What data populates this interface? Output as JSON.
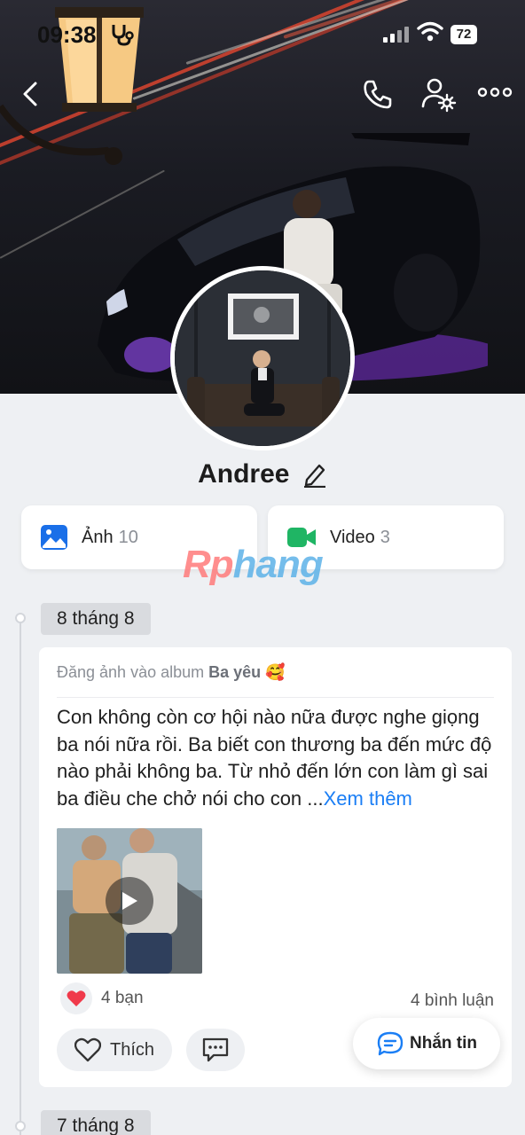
{
  "status_bar": {
    "time": "09:38",
    "battery": "72"
  },
  "header": {
    "back_icon": "chevron-left-icon",
    "call_icon": "phone-icon",
    "manage_icon": "user-settings-icon",
    "more_icon": "more-horizontal-icon"
  },
  "profile": {
    "name": "Andree"
  },
  "media": {
    "photos": {
      "label": "Ảnh",
      "count": "10",
      "color": "#1a6fe8"
    },
    "videos": {
      "label": "Video",
      "count": "3",
      "color": "#1fb564"
    }
  },
  "watermark": {
    "part1": "Rp",
    "part2": "hang"
  },
  "timeline": [
    {
      "date": "8 tháng 8",
      "post": {
        "meta_prefix": "Đăng ảnh vào album",
        "album": "Ba yêu",
        "emoji": "🥰",
        "text": "Con không còn cơ hội nào nữa được nghe giọng ba nói nữa rồi. Ba biết con thương ba đến mức độ nào phải không ba. Từ nhỏ đến lớn con làm gì sai ba điều che chở nói cho con ...",
        "see_more": "Xem thêm",
        "reactions": "4 bạn",
        "comments": "4 bình luận",
        "like_label": "Thích"
      }
    },
    {
      "date": "7 tháng 8"
    }
  ],
  "message_button": {
    "label": "Nhắn tin"
  },
  "colors": {
    "accent": "#1a7ef5",
    "background": "#eef0f3",
    "heart": "#f03a4b"
  }
}
